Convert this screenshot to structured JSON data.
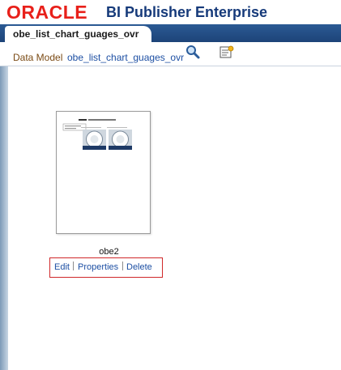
{
  "header": {
    "logo_text": "ORACLE",
    "app_title": "BI Publisher Enterprise"
  },
  "tab": {
    "label": "obe_list_chart_guages_ovr"
  },
  "toolbar": {
    "data_model_label": "Data Model",
    "layout_link": "obe_list_chart_guages_ovr",
    "icons": [
      "search-icon",
      "properties-icon"
    ]
  },
  "layout": {
    "name": "obe2",
    "actions": {
      "edit": "Edit",
      "properties": "Properties",
      "delete": "Delete"
    }
  },
  "colors": {
    "oracle_red": "#e8201a",
    "title_blue": "#163a7a",
    "tab_bar": "#1d4478",
    "link_blue": "#1d4fa3",
    "highlight_box": "#d0282a"
  }
}
